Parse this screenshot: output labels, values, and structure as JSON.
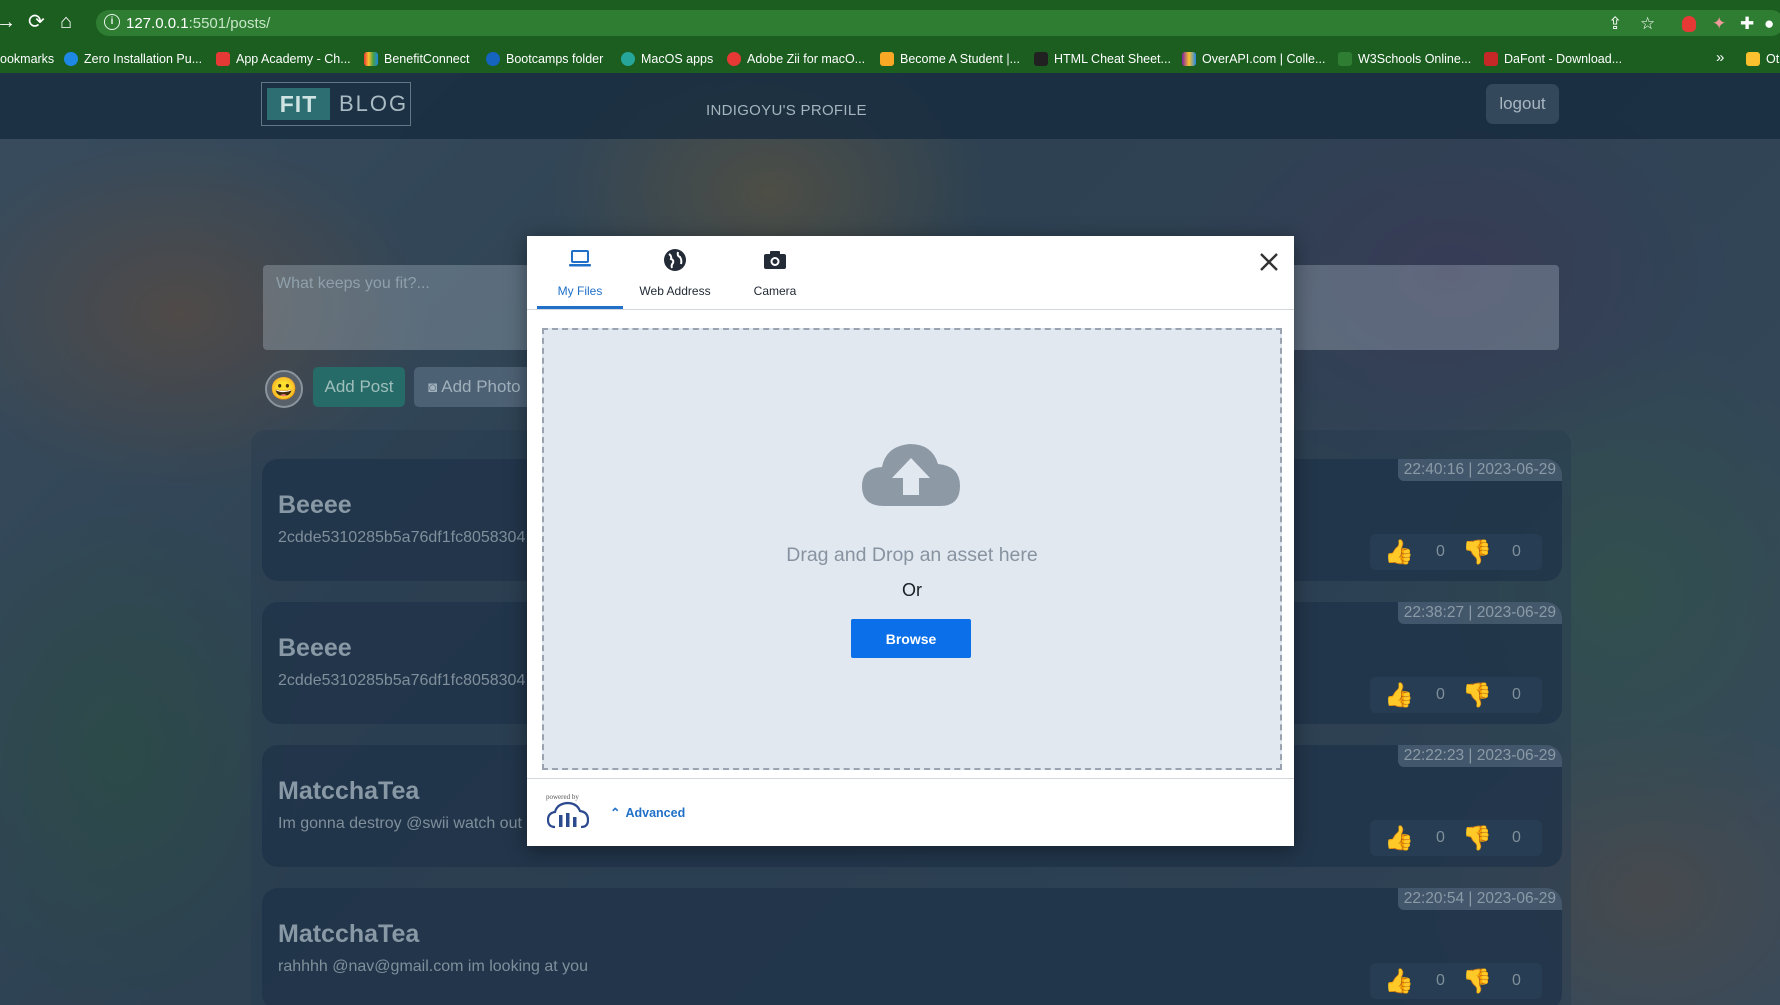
{
  "browser": {
    "url_host": "127.0.0.1",
    "url_path": ":5501/posts/",
    "bookmarks": [
      {
        "label": "ookmarks",
        "color": "#1b5e20"
      },
      {
        "label": "Zero Installation Pu...",
        "color": "#1e88e5"
      },
      {
        "label": "App Academy - Ch...",
        "color": "#e53935"
      },
      {
        "label": "BenefitConnect",
        "color": "#8e24aa"
      },
      {
        "label": "Bootcamps folder",
        "color": "#1565c0"
      },
      {
        "label": "MacOS apps",
        "color": "#26a69a"
      },
      {
        "label": "Adobe Zii for macO...",
        "color": "#e53935"
      },
      {
        "label": "Become A Student |...",
        "color": "#f9a825"
      },
      {
        "label": "HTML Cheat Sheet...",
        "color": "#212121"
      },
      {
        "label": "OverAPI.com | Colle...",
        "color": "#7b1fa2"
      },
      {
        "label": "W3Schools Online...",
        "color": "#2e7d32"
      },
      {
        "label": "DaFont - Download...",
        "color": "#c62828"
      },
      {
        "label": "Ot",
        "color": "#fbc02d"
      }
    ],
    "more_bookmarks": "»"
  },
  "navbar": {
    "logo_fit": "FIT",
    "logo_blog": "BLOG",
    "profile_title": "INDIGOYU'S PROFILE",
    "logout_label": "logout"
  },
  "composer": {
    "placeholder": "What keeps you fit?...",
    "emoji": "😀",
    "add_post_label": "Add Post",
    "add_photo_label": "Add Photo"
  },
  "posts": [
    {
      "author": "Beeee",
      "body": "2cdde5310285b5a76df1fc8058304",
      "time": "22:40:16 | 2023-06-29",
      "likes": "0",
      "dislikes": "0"
    },
    {
      "author": "Beeee",
      "body": "2cdde5310285b5a76df1fc8058304",
      "time": "22:38:27 | 2023-06-29",
      "likes": "0",
      "dislikes": "0"
    },
    {
      "author": "MatcchaTea",
      "body": "Im gonna destroy @swii watch out",
      "time": "22:22:23 | 2023-06-29",
      "likes": "0",
      "dislikes": "0"
    },
    {
      "author": "MatcchaTea",
      "body": "rahhhh @nav@gmail.com im looking at you",
      "time": "22:20:54 | 2023-06-29",
      "likes": "0",
      "dislikes": "0"
    }
  ],
  "upload_widget": {
    "tabs": [
      {
        "label": "My Files",
        "icon": "laptop-icon",
        "active": true
      },
      {
        "label": "Web Address",
        "icon": "globe-icon",
        "active": false
      },
      {
        "label": "Camera",
        "icon": "camera-icon",
        "active": false
      }
    ],
    "drag_text": "Drag and Drop an asset here",
    "or_text": "Or",
    "browse_label": "Browse",
    "powered_by": "powered by",
    "advanced_label": "Advanced",
    "accent_color": "#0a6fe8"
  }
}
